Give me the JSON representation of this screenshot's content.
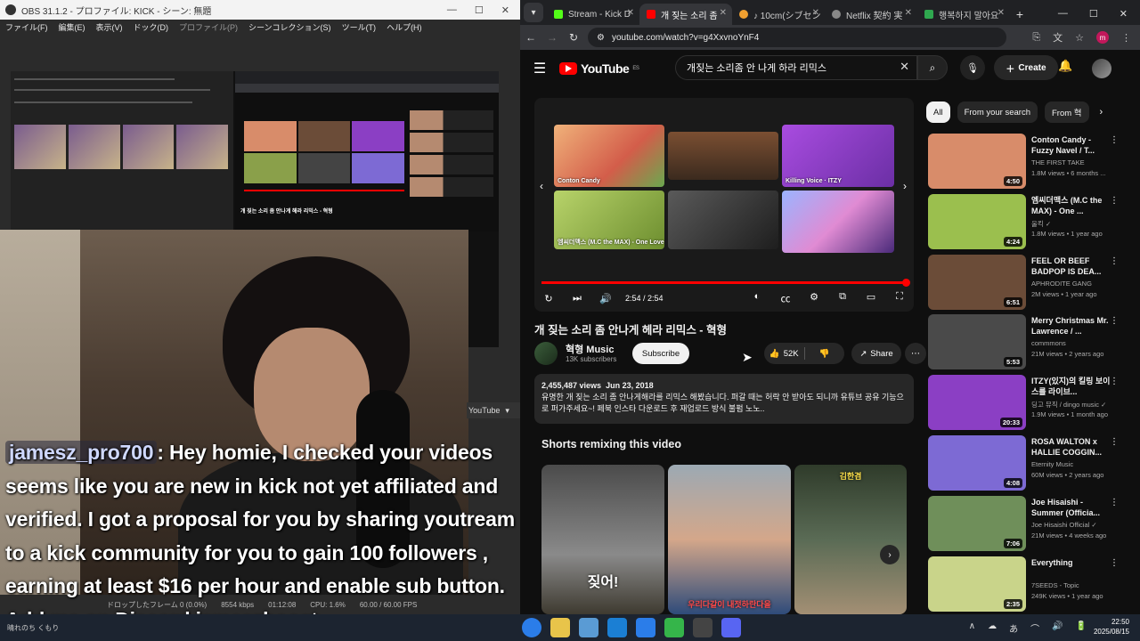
{
  "obs": {
    "title": "OBS 31.1.2 - プロファイル: KICK - シーン: 無題",
    "window_controls": [
      "—",
      "☐",
      "✕"
    ],
    "menu": [
      "ファイル(F)",
      "編集(E)",
      "表示(V)",
      "ドック(D)",
      "プロファイル(P)",
      "シーンコレクション(S)",
      "ツール(T)",
      "ヘルプ(H)"
    ],
    "preview_video_title": "개 짖는 소리 좀 안나게 해라 리믹스 - 혁형",
    "status": {
      "dropped_frames": "ドロップしたフレーム 0 (0.0%)",
      "bitrate": "8554 kbps",
      "time": "01:12:08",
      "cpu": "CPU: 1.6%",
      "fps": "60.00 / 60.00 FPS"
    },
    "youtube_tag": "YouTube"
  },
  "chat": {
    "username": "jamesz_pro700",
    "message": ": Hey homie, I checked your videos seems like you are new in kick not yet affiliated and verified. I got a proposal for you by sharing youtream to a kick community for you to gain 100 followers , earning at least $16 per hour and enable sub button. Add me on Discord jameszboost"
  },
  "browser": {
    "tabs": [
      {
        "label": "Stream - Kick D",
        "color": "#53fc18",
        "active": false
      },
      {
        "label": "개 짖는 소리 좀",
        "color": "#ff0000",
        "active": true
      },
      {
        "label": "♪ 10cm(シブセン",
        "color": "#f0a030",
        "active": false
      },
      {
        "label": "Netflix 契約 実",
        "color": "#888888",
        "active": false
      },
      {
        "label": "행복하지 말아요",
        "color": "#2fa84f",
        "active": false
      }
    ],
    "new_tab": "+",
    "window_controls": [
      "—",
      "☐",
      "✕"
    ],
    "url": "youtube.com/watch?v=g4XxvnoYnF4",
    "profile_initial": "m"
  },
  "youtube": {
    "logo_text": "YouTube",
    "region": "ES",
    "search_query": "개짖는 소리좀 안 나게 하라 리믹스",
    "create_label": "Create",
    "player": {
      "thumb_labels": [
        "Conton Candy",
        "",
        "Killing Voice · ITZY",
        "엠씨더맥스 (M.C the MAX) - One Love",
        "",
        ""
      ],
      "time": "2:54 / 2:54",
      "progress": 1.0
    },
    "video": {
      "title": "개 짖는 소리 좀 안나게 헤라 리믹스 - 혁형",
      "channel": "혁형 Music",
      "subscribers": "13K subscribers",
      "subscribe_label": "Subscribe",
      "likes": "52K",
      "share_label": "Share",
      "views": "2,455,487 views",
      "date": "Jun 23, 2018",
      "description": "유명한 개 짖는 소리 좀 안나게해라를 리믹스 해봤습니다. 퍼갈 때는 허락 안 받아도 되니까 유튜브 공유 기능으로 퍼가주세요~! 페북 인스타 다운로드 후 재업로드 방식 불펌 노노.."
    },
    "shorts": {
      "heading": "Shorts remixing this video",
      "items": [
        {
          "caption": "짖어!"
        },
        {
          "caption": "우리다같이 내젓하란다을"
        },
        {
          "caption": "김한겸"
        }
      ]
    },
    "chips": [
      "All",
      "From your search",
      "From 혁"
    ],
    "related": [
      {
        "title": "Conton Candy - Fuzzy Navel / T...",
        "channel": "THE FIRST TAKE",
        "meta": "1.8M views • 6 months ...",
        "duration": "4:50",
        "thumb": "#d88c6a"
      },
      {
        "title": "엠씨더맥스 (M.C the MAX) - One ...",
        "channel": "울킥 ✓",
        "meta": "1.8M views • 1 year ago",
        "duration": "4:24",
        "thumb": "#9bbf4e"
      },
      {
        "title": "FEEL OR BEEF BADPOP IS DEA...",
        "channel": "APHRODITE GANG",
        "meta": "2M views • 1 year ago",
        "duration": "6:51",
        "thumb": "#6b4c38"
      },
      {
        "title": "Merry Christmas Mr. Lawrence / ...",
        "channel": "commmons",
        "meta": "21M views • 2 years ago",
        "duration": "5:53",
        "thumb": "#4a4a4a"
      },
      {
        "title": "ITZY(있지)의 킬링 보이스를 라이브...",
        "channel": "딩고 뮤직 / dingo music ✓",
        "meta": "1.9M views • 1 month ago",
        "duration": "20:33",
        "thumb": "#8b3fc4"
      },
      {
        "title": "ROSA WALTON x HALLIE COGGIN...",
        "channel": "Eternity Music",
        "meta": "60M views • 2 years ago",
        "duration": "4:08",
        "thumb": "#7d6ad4"
      },
      {
        "title": "Joe Hisaishi - Summer (Officia...",
        "channel": "Joe Hisaishi Official ✓",
        "meta": "21M views • 4 weeks ago",
        "duration": "7:06",
        "thumb": "#6f8f5a"
      },
      {
        "title": "Everything",
        "channel": "7SEEDS - Topic",
        "meta": "249K views • 1 year ago",
        "duration": "2:35",
        "thumb": "#c9d48a"
      }
    ]
  },
  "taskbar": {
    "weather": "晴れのち くもり",
    "apps": [
      "#2b7de9",
      "#e8c44a",
      "#5a9bd4",
      "#1b7fd4",
      "#2b7de9",
      "#35b54a",
      "#444444",
      "#5865f2"
    ],
    "tray": [
      "∧",
      "☁",
      "あ",
      "⌒",
      "🔊",
      "🔋"
    ],
    "time": "22:50",
    "date": "2025/08/15"
  }
}
